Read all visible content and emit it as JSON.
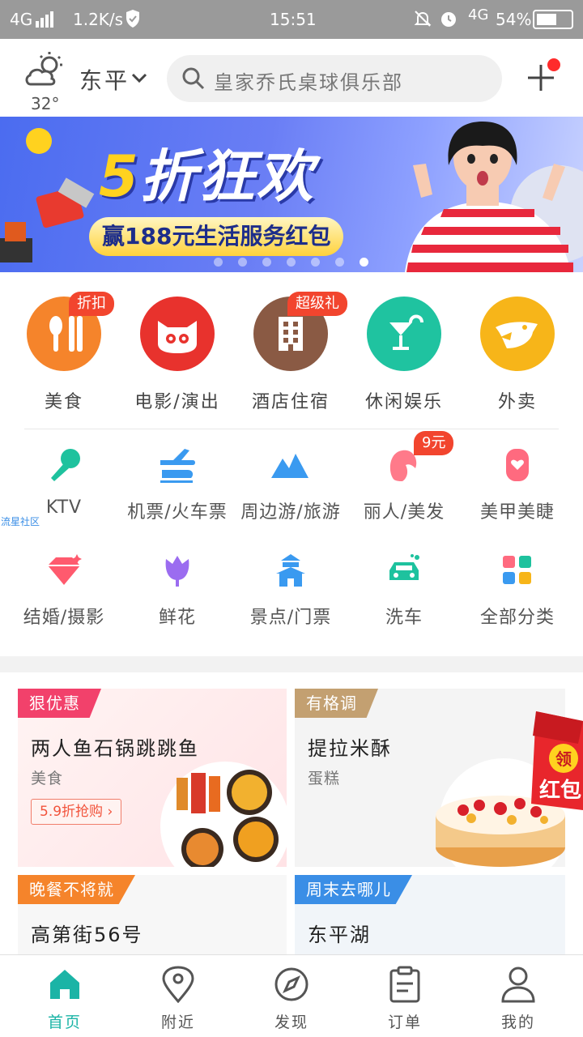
{
  "status_bar": {
    "network": "4G",
    "speed": "1.2K/s",
    "time": "15:51",
    "network2": "4G",
    "battery": "54%"
  },
  "header": {
    "temperature": "32°",
    "city": "东平",
    "search_placeholder": "皇家乔氏桌球俱乐部"
  },
  "banner": {
    "title_number": "5",
    "title_text": "折狂欢",
    "subtitle": "赢188元生活服务红包",
    "slide_count": 7,
    "active_slide": 7
  },
  "main_categories": [
    {
      "label": "美食",
      "tag": "折扣",
      "color": "#f5842b",
      "icon": "fork-knife-icon"
    },
    {
      "label": "电影/演出",
      "tag": "",
      "color": "#e8322d",
      "icon": "cat-face-icon"
    },
    {
      "label": "酒店住宿",
      "tag": "超级礼",
      "color": "#8a5a44",
      "icon": "building-icon"
    },
    {
      "label": "休闲娱乐",
      "tag": "",
      "color": "#1fc3a0",
      "icon": "cocktail-icon"
    },
    {
      "label": "外卖",
      "tag": "",
      "color": "#f7b519",
      "icon": "delivery-icon"
    }
  ],
  "sub_categories": [
    {
      "label": "KTV",
      "tag": "",
      "color": "#1ec29e",
      "icon": "microphone-icon"
    },
    {
      "label": "机票/火车票",
      "tag": "",
      "color": "#3a9af0",
      "icon": "plane-train-icon"
    },
    {
      "label": "周边游/旅游",
      "tag": "",
      "color": "#3a9af0",
      "icon": "mountain-icon"
    },
    {
      "label": "丽人/美发",
      "tag": "9元",
      "color": "#ff7a8a",
      "icon": "woman-hair-icon"
    },
    {
      "label": "美甲美睫",
      "tag": "",
      "color": "#ff6a7f",
      "icon": "nail-icon"
    },
    {
      "label": "结婚/摄影",
      "tag": "",
      "color": "#ff5a6e",
      "icon": "diamond-icon"
    },
    {
      "label": "鲜花",
      "tag": "",
      "color": "#9b6cf0",
      "icon": "tulip-icon"
    },
    {
      "label": "景点/门票",
      "tag": "",
      "color": "#3a9af0",
      "icon": "temple-icon"
    },
    {
      "label": "洗车",
      "tag": "",
      "color": "#1ec29e",
      "icon": "car-wash-icon"
    },
    {
      "label": "全部分类",
      "tag": "",
      "color": "#f0a030",
      "icon": "grid-icon"
    }
  ],
  "watermark": "流星社区",
  "deals": [
    {
      "badge": "狠优惠",
      "badge_color": "#f2416b",
      "title": "两人鱼石锅跳跳鱼",
      "subtitle": "美食",
      "button": "5.9折抢购 ›"
    },
    {
      "badge": "有格调",
      "badge_color": "#c3a071",
      "title": "提拉米酥",
      "subtitle": "蛋糕",
      "button": ""
    },
    {
      "badge": "晚餐不将就",
      "badge_color": "#f5842b",
      "title": "高第街56号",
      "subtitle": "",
      "button": ""
    },
    {
      "badge": "周末去哪儿",
      "badge_color": "#3a8ee6",
      "title": "东平湖",
      "subtitle": "",
      "button": ""
    }
  ],
  "red_packet": {
    "top": "领",
    "bottom": "红包"
  },
  "tabs": [
    {
      "label": "首页",
      "icon": "home-icon",
      "active": true
    },
    {
      "label": "附近",
      "icon": "location-pin-icon",
      "active": false
    },
    {
      "label": "发现",
      "icon": "compass-icon",
      "active": false
    },
    {
      "label": "订单",
      "icon": "order-list-icon",
      "active": false
    },
    {
      "label": "我的",
      "icon": "user-icon",
      "active": false
    }
  ]
}
